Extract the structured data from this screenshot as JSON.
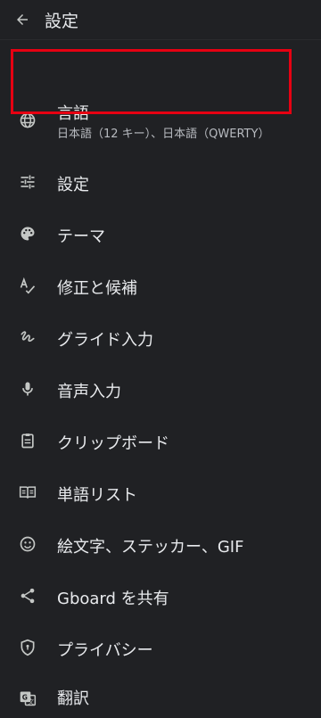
{
  "appbar": {
    "title": "設定",
    "back_icon": "arrow-back-icon"
  },
  "items": [
    {
      "label": "言語",
      "sublabel": "日本語（12 キー）、日本語（QWERTY）",
      "icon": "globe-icon"
    },
    {
      "label": "設定",
      "icon": "tune-icon"
    },
    {
      "label": "テーマ",
      "icon": "palette-icon"
    },
    {
      "label": "修正と候補",
      "icon": "spellcheck-icon"
    },
    {
      "label": "グライド入力",
      "icon": "gesture-icon"
    },
    {
      "label": "音声入力",
      "icon": "mic-icon"
    },
    {
      "label": "クリップボード",
      "icon": "clipboard-icon"
    },
    {
      "label": "単語リスト",
      "icon": "book-icon"
    },
    {
      "label": "絵文字、ステッカー、GIF",
      "icon": "smiley-icon"
    },
    {
      "label": "Gboard を共有",
      "icon": "share-icon"
    },
    {
      "label": "プライバシー",
      "icon": "shield-icon"
    },
    {
      "label": "翻訳",
      "icon": "translate-icon"
    }
  ],
  "colors": {
    "background": "#202124",
    "text": "#e8eaed",
    "subtext": "#b8bbc0",
    "highlight": "#e60012"
  }
}
